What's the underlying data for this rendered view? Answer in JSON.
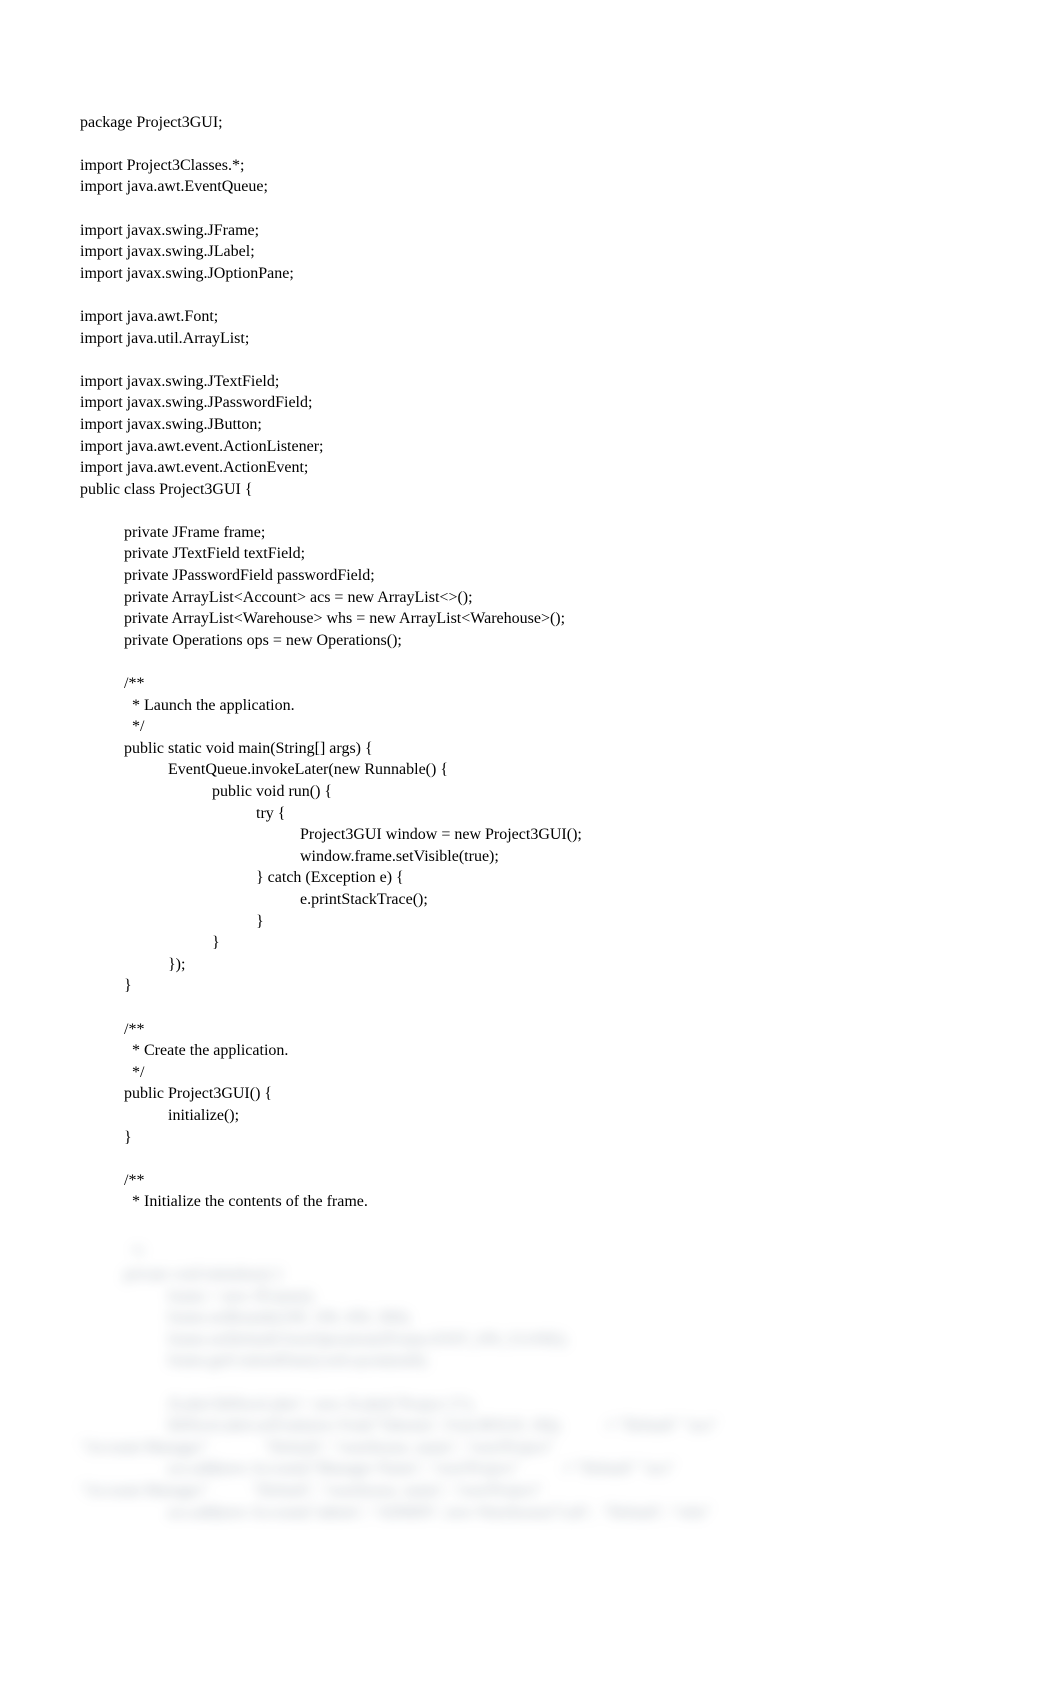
{
  "code": {
    "lines": [
      "package Project3GUI;",
      "",
      "import Project3Classes.*;",
      "import java.awt.EventQueue;",
      "",
      "import javax.swing.JFrame;",
      "import javax.swing.JLabel;",
      "import javax.swing.JOptionPane;",
      "",
      "import java.awt.Font;",
      "import java.util.ArrayList;",
      "",
      "import javax.swing.JTextField;",
      "import javax.swing.JPasswordField;",
      "import javax.swing.JButton;",
      "import java.awt.event.ActionListener;",
      "import java.awt.event.ActionEvent;",
      "public class Project3GUI {",
      "",
      "           private JFrame frame;",
      "           private JTextField textField;",
      "           private JPasswordField passwordField;",
      "           private ArrayList<Account> acs = new ArrayList<>();",
      "           private ArrayList<Warehouse> whs = new ArrayList<Warehouse>();",
      "           private Operations ops = new Operations();",
      "",
      "           /**",
      "             * Launch the application.",
      "             */",
      "           public static void main(String[] args) {",
      "                      EventQueue.invokeLater(new Runnable() {",
      "                                 public void run() {",
      "                                            try {",
      "                                                       Project3GUI window = new Project3GUI();",
      "                                                       window.frame.setVisible(true);",
      "                                            } catch (Exception e) {",
      "                                                       e.printStackTrace();",
      "                                            }",
      "                                 }",
      "                      });",
      "           }",
      "",
      "           /**",
      "             * Create the application.",
      "             */",
      "           public Project3GUI() {",
      "                      initialize();",
      "           }",
      "",
      "           /**",
      "             * Initialize the contents of the frame."
    ],
    "blurred_lines": [
      "             */",
      "           private void initialize() {",
      "                      frame = new JFrame();",
      "                      frame.setBounds(100, 100, 450, 300);",
      "                      frame.setDefaultCloseOperation(JFrame.EXIT_ON_CLOSE);",
      "                      frame.getContentPane().setLayout(null);",
      "",
      "                      JLabel lblNewLabel = new JLabel(\"Project 3\");",
      "                      lblNewLabel.setFont(new Font(\"Tahoma\", Font.BOLD, 18));           // \"Default\" \"acs\"",
      "\"Account Manager\"              \"Default\", \"warehouse, name\", \"root/Project\"",
      "                      acs.add(new Account(\"Manager Name\", \"root/Project\"           // \"Default\" \"acs\"",
      "\"Account Manager\"           \"Default\", \"warehouse, name\", \"root/Project\"",
      "                      acs.add(new Account(\"admin\", \"ADMIN\", new Warehouse(\"Lab\",  \"Default\", \"whs\""
    ]
  }
}
